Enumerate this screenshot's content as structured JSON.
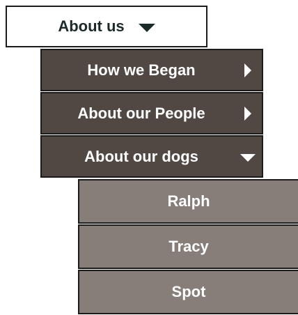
{
  "top_menu": {
    "label": "About us",
    "icon": "caret-down-icon"
  },
  "submenu": {
    "items": [
      {
        "label": "How we Began",
        "icon": "caret-right-icon"
      },
      {
        "label": "About our People",
        "icon": "caret-right-icon"
      },
      {
        "label": "About our dogs",
        "icon": "caret-down-icon"
      }
    ]
  },
  "dogs_menu": {
    "items": [
      {
        "label": "Ralph"
      },
      {
        "label": "Tracy"
      },
      {
        "label": "Spot"
      }
    ]
  },
  "colors": {
    "top_bg": "#ffffff",
    "sub_bg": "#514743",
    "subsub_bg": "#877e7a",
    "border": "#1b1b1b",
    "top_text": "#1c2a2a",
    "light_text": "#ffffff"
  }
}
